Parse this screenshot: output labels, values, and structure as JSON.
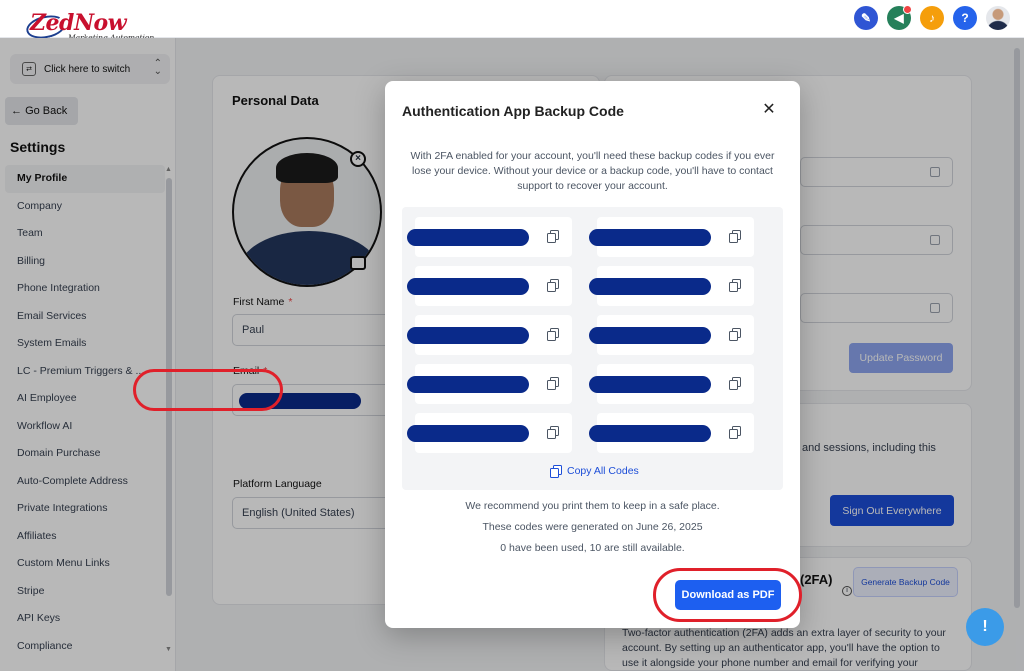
{
  "brand": {
    "name": "ZedNow",
    "tagline": "Marketing Automation"
  },
  "switcher": {
    "label": "Click here to switch"
  },
  "nav": {
    "go_back": "Go Back",
    "settings_title": "Settings",
    "items": [
      {
        "label": "My Profile",
        "active": true
      },
      {
        "label": "Company"
      },
      {
        "label": "Team"
      },
      {
        "label": "Billing"
      },
      {
        "label": "Phone Integration"
      },
      {
        "label": "Email Services"
      },
      {
        "label": "System Emails"
      },
      {
        "label": "LC - Premium Triggers & ..."
      },
      {
        "label": "AI Employee"
      },
      {
        "label": "Workflow AI"
      },
      {
        "label": "Domain Purchase"
      },
      {
        "label": "Auto-Complete Address"
      },
      {
        "label": "Private Integrations"
      },
      {
        "label": "Affiliates"
      },
      {
        "label": "Custom Menu Links"
      },
      {
        "label": "Stripe"
      },
      {
        "label": "API Keys"
      },
      {
        "label": "Compliance"
      }
    ]
  },
  "personal_data": {
    "title": "Personal Data",
    "first_name_label": "First Name",
    "first_name_value": "Paul",
    "email_label": "Email",
    "required_mark": "*",
    "language_label": "Platform Language",
    "language_value": "English (United States)"
  },
  "security": {
    "update_password": "Update Password",
    "sessions_text": "and sessions, including this",
    "sign_out_everywhere": "Sign Out Everywhere",
    "tfa_title": "(2FA)",
    "generate_backup": "Generate Backup Code",
    "tfa_desc_1": "Two-factor authentication (2FA) adds an extra layer of security to your",
    "tfa_desc_2": "account. By setting up an authenticator app, you'll have the option to",
    "tfa_desc_3": "use it alongside your phone number and email for verifying your"
  },
  "modal": {
    "title": "Authentication App Backup Code",
    "description": "With 2FA enabled for your account, you'll need these backup codes if you ever lose your device. Without your device or a backup code, you'll have to contact support to recover your account.",
    "code_count": 10,
    "copy_all": "Copy All Codes",
    "print_note": "We recommend you print them to keep in a safe place.",
    "generated_note": "These codes were generated on June 26, 2025",
    "usage_note": "0 have been used, 10 are still available.",
    "download_pdf": "Download as PDF"
  },
  "colors": {
    "primary": "#1d5ff0",
    "redaction": "#0a2a8a",
    "annotation_highlight": "#e0202a"
  },
  "icons": [
    "pencil-icon",
    "megaphone-icon",
    "bell-icon",
    "help-icon",
    "chat-icon",
    "copy-icon",
    "close-icon",
    "camera-icon"
  ]
}
